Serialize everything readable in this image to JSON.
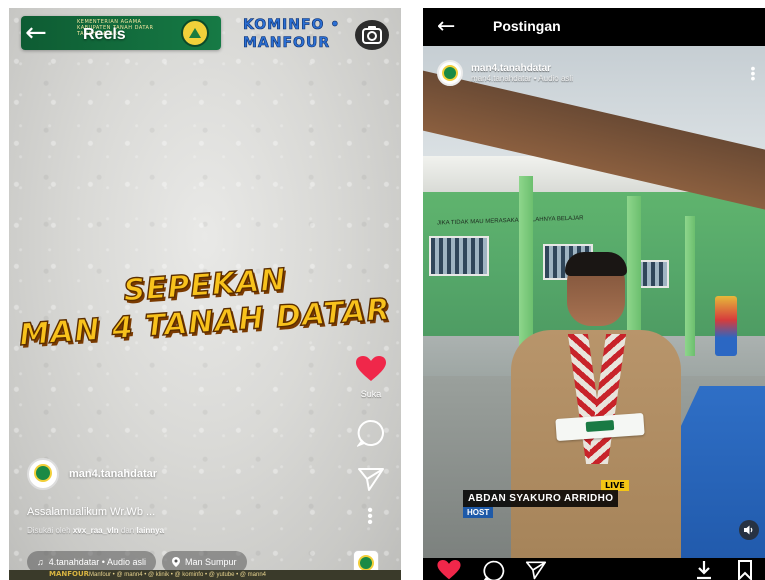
{
  "reel": {
    "back_icon": "arrow-left-icon",
    "title": "Reels",
    "banner": {
      "line1": "KEMENTERIAN AGAMA",
      "line2": "KABUPATEN TANAH DATAR",
      "line3": "TANAH DATAR"
    },
    "watermark_line1": "KOMINFO",
    "watermark_line2": "MANFOUR",
    "camera_icon": "camera-icon",
    "headline_line1": "SEPEKAN",
    "headline_line2": "MAN 4 TANAH DATAR",
    "like_label": "Suka",
    "owner_name": "man4.tanahdatar",
    "caption": "Assalamualikum Wr.Wb ...",
    "collab_prefix": "Disukai oleh",
    "collab_user": "xvx_raa_vln",
    "collab_mid": "dan",
    "collab_rest": "lainnya",
    "audio_chip": "4.tanahdatar • Audio asli",
    "location_chip": "Man Sumpur",
    "ticker_logo": "MANFOUR",
    "ticker_text": "Manfour • @ mann4 • @ klinik • @ kominfo • @ yutube • @ mann4"
  },
  "post": {
    "title": "Postingan",
    "owner_name": "man4.tanahdatar",
    "owner_sub": "man4.tanahdatar • Audio asli",
    "wall_text": "JIKA TIDAK MAU MERASAKAN LELAHNYA BELAJAR",
    "live_label": "LIVE",
    "host_name": "ABDAN SYAKURO ARRIDHO",
    "host_role": "HOST"
  },
  "colors": {
    "like_red": "#f0274a",
    "banner_green": "#0e5c33",
    "headline_yellow": "#f8c21c",
    "live_yellow": "#f4c615",
    "role_blue": "#1e5aa8"
  }
}
